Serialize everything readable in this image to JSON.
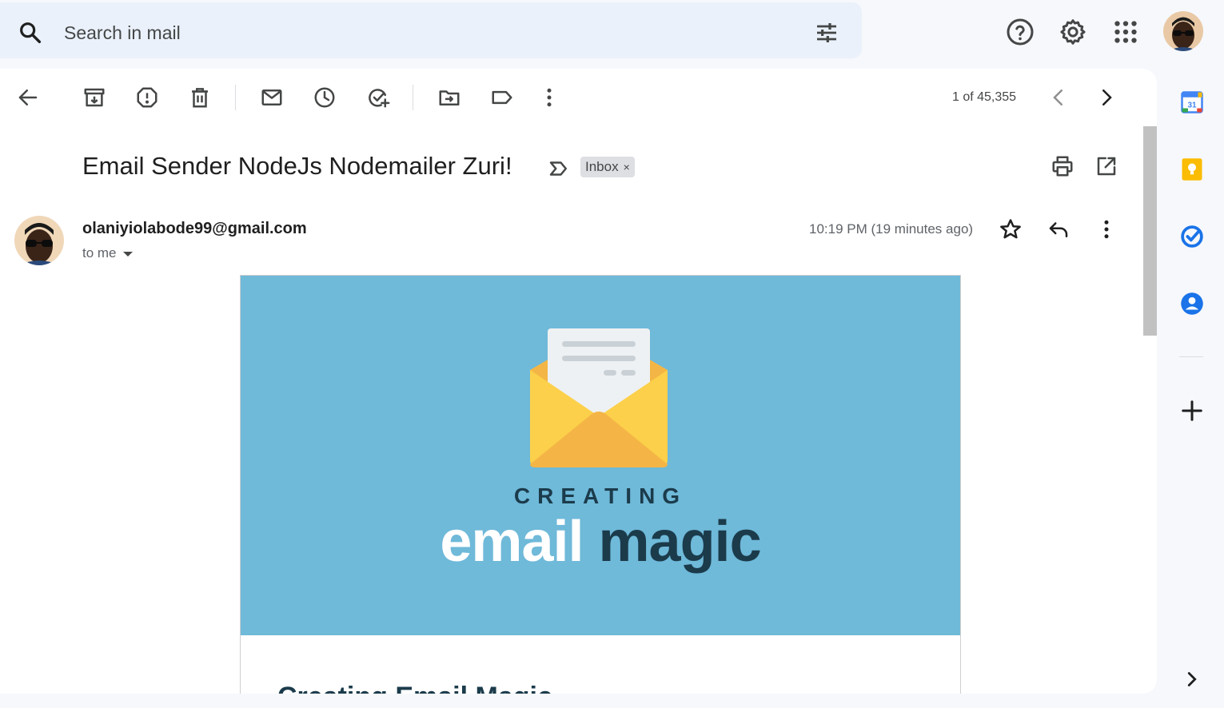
{
  "search": {
    "placeholder": "Search in mail"
  },
  "toolbar": {
    "pager_text": "1 of 45,355"
  },
  "message": {
    "subject": "Email Sender NodeJs Nodemailer Zuri!",
    "label_chip": "Inbox",
    "label_chip_remove": "×",
    "sender": "olaniyiolabode99@gmail.com",
    "recipient_line": "to me",
    "timestamp": "10:19 PM (19 minutes ago)"
  },
  "email_body": {
    "hero_kicker": "CREATING",
    "hero_word1": "email",
    "hero_word2": "magic",
    "heading_partial": "Creating Email Magic",
    "hero_bg_color": "#6fb9d9",
    "hero_dark_color": "#1b3b4b"
  },
  "icons": {
    "toolbar": [
      "back-arrow-icon",
      "archive-icon",
      "report-spam-icon",
      "delete-icon",
      "mark-unread-icon",
      "snooze-icon",
      "add-to-tasks-icon",
      "move-to-icon",
      "label-icon",
      "more-vert-icon",
      "prev-chevron-icon",
      "next-chevron-icon"
    ],
    "rail": [
      "google-calendar-icon",
      "google-keep-icon",
      "google-tasks-icon",
      "google-contacts-icon",
      "add-icon",
      "expand-chevron-icon"
    ]
  },
  "rail": {
    "calendar_day": "31"
  }
}
